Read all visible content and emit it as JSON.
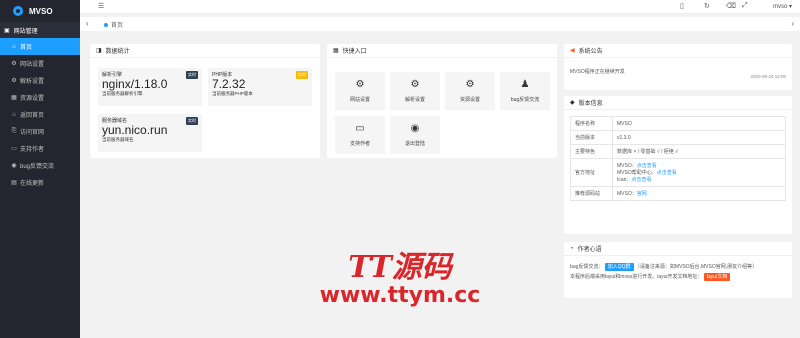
{
  "app": {
    "logo_text": "MVSO",
    "user": "mvso ▾"
  },
  "sidebar": {
    "group_label": "网站管理",
    "items": [
      {
        "label": "首页",
        "icon": "home-icon",
        "glyph": "⌂"
      },
      {
        "label": "网站设置",
        "icon": "gear-icon",
        "glyph": "⚙"
      },
      {
        "label": "解析设置",
        "icon": "gear-icon",
        "glyph": "⚙"
      },
      {
        "label": "资源设置",
        "icon": "grid-icon",
        "glyph": "▦"
      },
      {
        "label": "返回首页",
        "icon": "home-icon",
        "glyph": "⌂"
      },
      {
        "label": "访问官网",
        "icon": "link-icon",
        "glyph": "⎘"
      },
      {
        "label": "支持作者",
        "icon": "card-icon",
        "glyph": "▭"
      },
      {
        "label": "bug反馈交流",
        "icon": "chat-icon",
        "glyph": "◉"
      },
      {
        "label": "在线更新",
        "icon": "refresh-icon",
        "glyph": "▤"
      }
    ]
  },
  "tabs": {
    "current": "首页"
  },
  "stats": {
    "title": "数据统计",
    "server_label": "解析引擎",
    "server_value": "nginx/1.18.0",
    "server_sub": "当前服务器解析引擎",
    "php_label": "PHP版本",
    "php_value": "7.2.32",
    "php_sub": "当前服务器PHP版本",
    "domain_label": "服务器域名",
    "domain_value": "yun.nico.run",
    "domain_sub": "当前服务器域名",
    "badge_text": "实时",
    "badge_php_text": "实时"
  },
  "quick": {
    "title": "快捷入口",
    "items": [
      "网站设置",
      "解析设置",
      "资源设置",
      "bug反馈交流",
      "支持作者",
      "退出登陆"
    ]
  },
  "announce": {
    "title": "系统公告",
    "text": "MVSO程序正在继续开发",
    "date": "2020-06-24 12:00"
  },
  "version": {
    "title": "版本信息",
    "rows": [
      {
        "k": "程序名称",
        "v": "MVSO"
      },
      {
        "k": "当前版本",
        "v": "v1.3.0"
      },
      {
        "k": "主要特色",
        "v": "数据库 × / 零基础 √ / 拒绝 √"
      },
      {
        "k": "官方地址",
        "l1": "MVSO：",
        "v1": "点击查看",
        "l2": "MVSO帮助中心：",
        "v2": "点击查看",
        "l3": "Ican：",
        "v3": "点击查看"
      },
      {
        "k": "推荐源码站",
        "l": "MVSO：",
        "v": "官网"
      }
    ]
  },
  "dev": {
    "title": "作者心语",
    "l1_pre": "bug反馈交流：",
    "l1_tag": "加入QQ群",
    "l1_post": "（请备注来源：如MVSO后台,MVSO官网,朋友介绍等）",
    "l2_pre": "本程序后端采用layui和mvso进行开发。layui开发文档地址：",
    "l2_tag": "layui文档"
  },
  "watermark": {
    "line1": "TT源码",
    "line2": "www.ttym.cc"
  }
}
